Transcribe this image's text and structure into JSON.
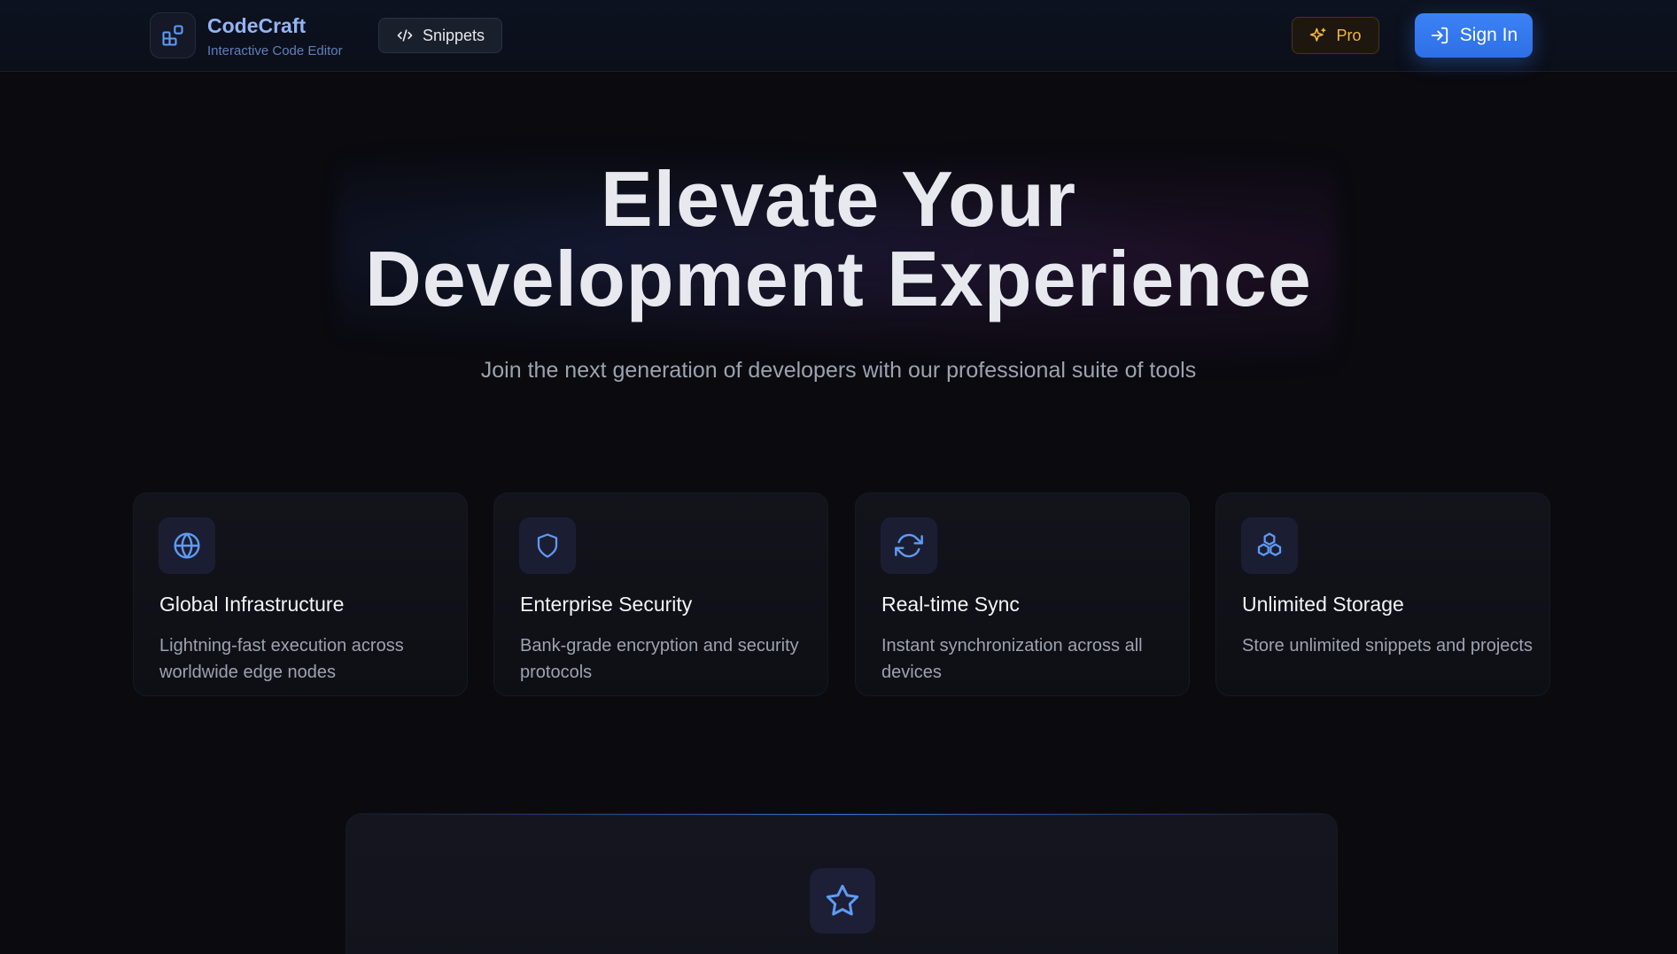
{
  "header": {
    "brand_name": "CodeCraft",
    "brand_subtitle": "Interactive Code Editor",
    "logo_icon": "blocks-icon",
    "snippets_label": "Snippets",
    "snippets_icon": "code-icon",
    "pro_label": "Pro",
    "pro_icon": "sparkles-icon",
    "signin_label": "Sign In",
    "signin_icon": "log-in-icon"
  },
  "hero": {
    "title_line1": "Elevate Your",
    "title_line2": "Development Experience",
    "subtitle": "Join the next generation of developers with our professional suite of tools"
  },
  "features": [
    {
      "icon": "globe-icon",
      "title": "Global Infrastructure",
      "description": "Lightning-fast execution across worldwide edge nodes"
    },
    {
      "icon": "shield-icon",
      "title": "Enterprise Security",
      "description": "Bank-grade encryption and security protocols"
    },
    {
      "icon": "refresh-icon",
      "title": "Real-time Sync",
      "description": "Instant synchronization across all devices"
    },
    {
      "icon": "boxes-icon",
      "title": "Unlimited Storage",
      "description": "Store unlimited snippets and projects"
    }
  ],
  "pricing_panel": {
    "icon": "star-icon"
  },
  "colors": {
    "accent": "#3b82f6",
    "brand_text": "#93b4f5",
    "pro_gold": "#f2b63a",
    "background": "#0a0a0f"
  }
}
